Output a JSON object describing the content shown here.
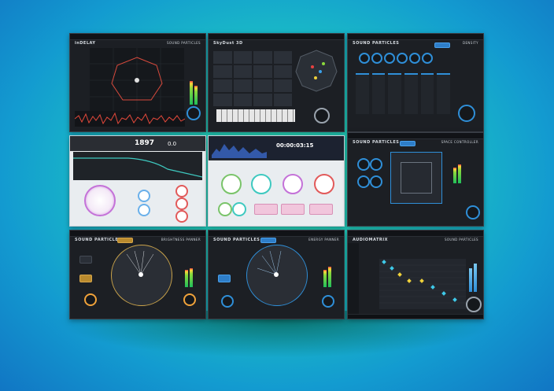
{
  "colors": {
    "accent_blue": "#2f8fd8",
    "accent_orange": "#f0a23a",
    "meter_green": "#1fbf5a",
    "panel_bg": "#1c1f24"
  },
  "panels": {
    "p1": {
      "brand": "inDELAY",
      "right": "SOUND PARTICLES"
    },
    "p2": {
      "brand": "SkyDust 3D",
      "right": ""
    },
    "p3": {
      "brand": "SOUND PARTICLES",
      "right": "DENSITY"
    },
    "p4": {
      "counter": "1897",
      "value": "0.0"
    },
    "p5": {
      "timecode": "00:00:03:15"
    },
    "p6": {
      "brand": "SOUND PARTICLES",
      "right": "SPACE CONTROLLER"
    },
    "p7": {
      "brand": "SOUND PARTICLES",
      "right": "BRIGHTNESS PANNER"
    },
    "p8": {
      "brand": "SOUND PARTICLES",
      "right": "ENERGY PANNER"
    },
    "p9": {
      "brand": "AUDIOMATRIX",
      "right": "SOUND PARTICLES"
    }
  }
}
